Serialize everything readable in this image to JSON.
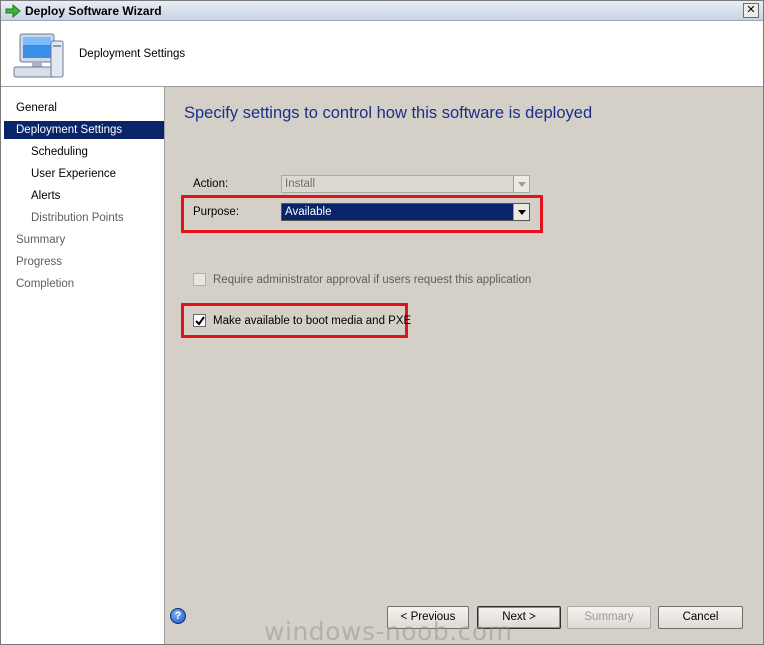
{
  "window": {
    "title": "Deploy Software Wizard",
    "close_glyph": "✕"
  },
  "header": {
    "title": "Deployment Settings"
  },
  "sidebar": {
    "items": [
      {
        "label": "General"
      },
      {
        "label": "Deployment Settings"
      },
      {
        "label": "Scheduling"
      },
      {
        "label": "User Experience"
      },
      {
        "label": "Alerts"
      },
      {
        "label": "Distribution Points"
      },
      {
        "label": "Summary"
      },
      {
        "label": "Progress"
      },
      {
        "label": "Completion"
      }
    ]
  },
  "main": {
    "heading": "Specify settings to control how this software is deployed",
    "action": {
      "label": "Action:",
      "value": "Install"
    },
    "purpose": {
      "label": "Purpose:",
      "value": "Available"
    },
    "require_approval": {
      "label": "Require administrator approval if users request this application",
      "checked": false
    },
    "boot_media": {
      "label": "Make available to boot media and PXE",
      "checked": true
    }
  },
  "buttons": {
    "previous": "< Previous",
    "next": "Next >",
    "summary": "Summary",
    "cancel": "Cancel",
    "help": "?"
  },
  "watermark": "windows-noob.com",
  "colors": {
    "selection": "#0a246a",
    "heading": "#1a2f8a",
    "highlight": "#e3121b"
  }
}
